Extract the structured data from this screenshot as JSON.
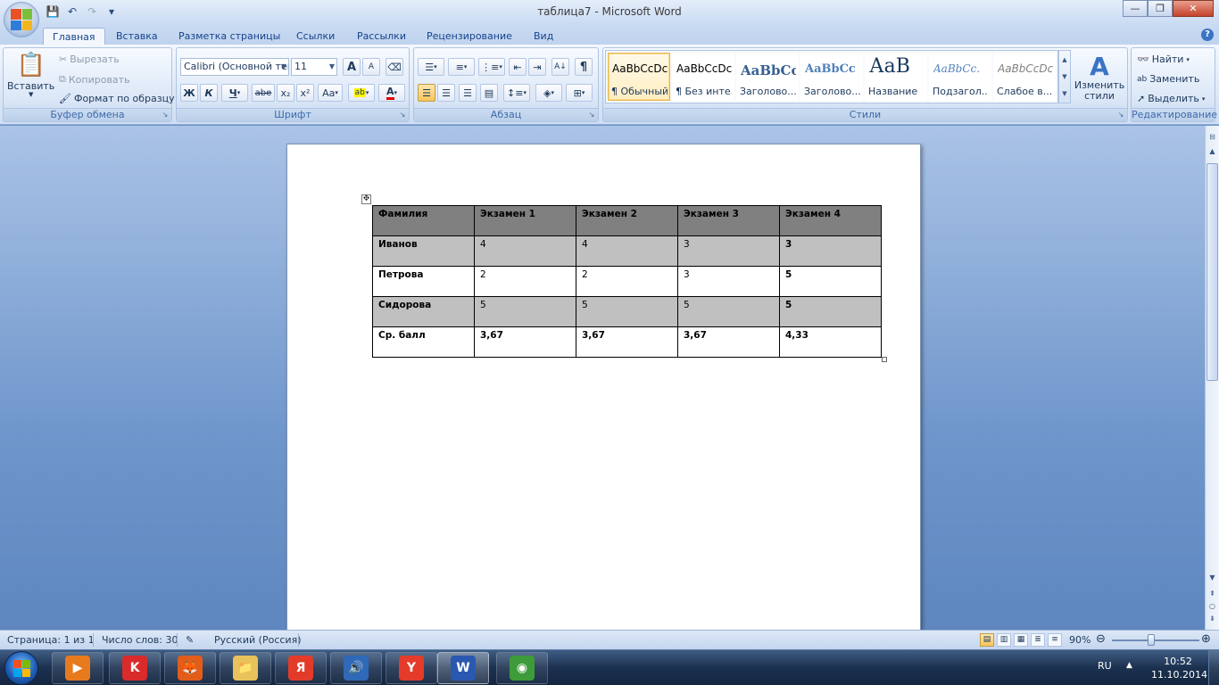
{
  "window": {
    "title": "таблица7 - Microsoft Word",
    "minimize": "—",
    "maximize": "❐",
    "close": "✕"
  },
  "qat": {
    "save": "💾",
    "undo": "↶",
    "redo": "↷",
    "more": "▾"
  },
  "tabs": [
    {
      "label": "Главная"
    },
    {
      "label": "Вставка"
    },
    {
      "label": "Разметка страницы"
    },
    {
      "label": "Ссылки"
    },
    {
      "label": "Рассылки"
    },
    {
      "label": "Рецензирование"
    },
    {
      "label": "Вид"
    }
  ],
  "help": "?",
  "clipboard": {
    "group_label": "Буфер обмена",
    "paste": "Вставить",
    "cut": "Вырезать",
    "copy": "Копировать",
    "format_painter": "Формат по образцу"
  },
  "font": {
    "group_label": "Шрифт",
    "font_name": "Calibri (Основной текст)",
    "font_size": "11",
    "grow": "A",
    "shrink": "A",
    "bold": "Ж",
    "italic": "К",
    "underline": "Ч",
    "strike": "abe",
    "subscript": "x₂",
    "superscript": "x²",
    "change_case": "Aa",
    "highlight": "ab",
    "font_color": "A"
  },
  "paragraph": {
    "group_label": "Абзац",
    "pilcrow": "¶"
  },
  "styles": {
    "group_label": "Стили",
    "items": [
      {
        "sample": "AaBbCcDc",
        "name": "¶ Обычный"
      },
      {
        "sample": "AaBbCcDc",
        "name": "¶ Без инте..."
      },
      {
        "sample": "AaBbCc",
        "name": "Заголово..."
      },
      {
        "sample": "AaBbCc",
        "name": "Заголово..."
      },
      {
        "sample": "АаВ",
        "name": "Название"
      },
      {
        "sample": "AaBbCc.",
        "name": "Подзагол..."
      },
      {
        "sample": "AaBbCcDc",
        "name": "Слабое в..."
      }
    ],
    "change_styles": "Изменить стили"
  },
  "editing": {
    "group_label": "Редактирование",
    "find": "Найти",
    "replace": "Заменить",
    "select": "Выделить"
  },
  "table": {
    "headers": [
      "Фамилия",
      "Экзамен 1",
      "Экзамен 2",
      "Экзамен 3",
      "Экзамен 4"
    ],
    "rows": [
      [
        "Иванов",
        "4",
        "4",
        "3",
        "3"
      ],
      [
        "Петрова",
        "2",
        "2",
        "3",
        "5"
      ],
      [
        "Сидорова",
        "5",
        "5",
        "5",
        "5"
      ],
      [
        "Ср.  балл",
        "3,67",
        "3,67",
        "3,67",
        "4,33"
      ]
    ]
  },
  "status": {
    "page": "Страница: 1 из 1",
    "words": "Число слов: 30",
    "language": "Русский (Россия)",
    "zoom": "90%",
    "zoom_level": 0.9
  },
  "taskbar": {
    "lang": "RU",
    "time": "10:52",
    "date": "11.10.2014",
    "apps": [
      {
        "name": "media-player",
        "glyph": "▶",
        "color": "#e87a1e"
      },
      {
        "name": "red-app",
        "glyph": "K",
        "color": "#d92b2b"
      },
      {
        "name": "firefox",
        "glyph": "🦊",
        "color": "#e35d1a"
      },
      {
        "name": "explorer",
        "glyph": "📁",
        "color": "#e8c25b"
      },
      {
        "name": "yandex",
        "glyph": "Я",
        "color": "#e33b2a"
      },
      {
        "name": "sound",
        "glyph": "🔊",
        "color": "#2f69b8"
      },
      {
        "name": "yandex-browser",
        "glyph": "Y",
        "color": "#e53b2a"
      },
      {
        "name": "word",
        "glyph": "W",
        "color": "#2a58b0"
      },
      {
        "name": "chrome",
        "glyph": "◉",
        "color": "#3e9b3a"
      }
    ]
  },
  "colors": {
    "header_row": "#808080",
    "alt_row": "#c0c0c0",
    "accent": "#15428b"
  }
}
